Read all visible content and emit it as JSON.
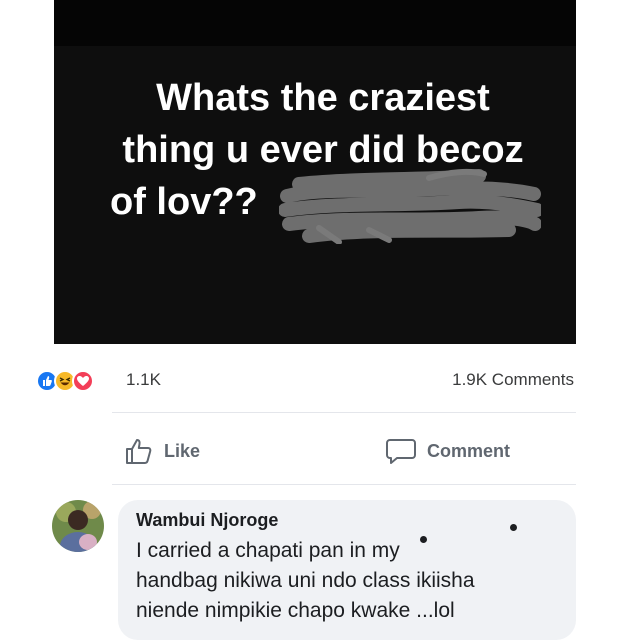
{
  "post": {
    "image_text_lines": [
      "Whats the craziest",
      "thing u ever did becoz",
      "of lov??"
    ],
    "image_background": "#0e0e0e"
  },
  "reactions": {
    "icons": [
      "like-icon",
      "haha-icon",
      "love-icon"
    ],
    "colors": {
      "like": "#1877f2",
      "haha": "#f7b928",
      "love": "#f33e58"
    },
    "count": "1.1K",
    "comments_count": "1.9K Comments"
  },
  "actions": {
    "like_label": "Like",
    "comment_label": "Comment"
  },
  "comment": {
    "author": "Wambui Njoroge",
    "lines": [
      "I carried a chapati pan  in my",
      "handbag nikiwa uni ndo class ikiisha",
      "niende nimpikie chapo kwake ...lol"
    ]
  },
  "colors": {
    "bubble": "#f0f2f5",
    "muted_text": "#606770",
    "divider": "#e4e6eb"
  }
}
